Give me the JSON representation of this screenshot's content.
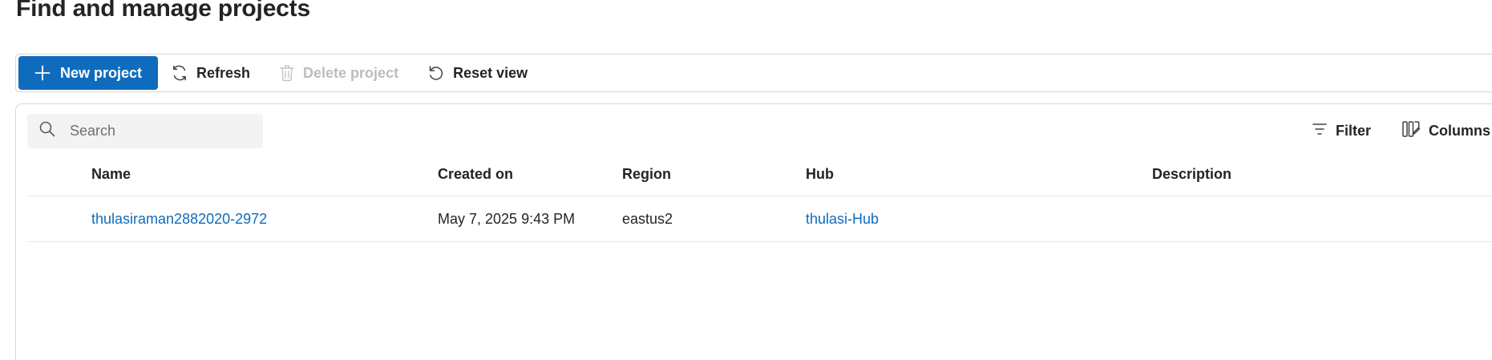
{
  "page": {
    "title": "Find and manage projects"
  },
  "toolbar": {
    "new_project_label": "New project",
    "refresh_label": "Refresh",
    "delete_project_label": "Delete project",
    "reset_view_label": "Reset view"
  },
  "grid": {
    "search_placeholder": "Search",
    "filter_label": "Filter",
    "columns_label": "Columns",
    "headers": {
      "name": "Name",
      "created_on": "Created on",
      "region": "Region",
      "hub": "Hub",
      "description": "Description"
    },
    "rows": [
      {
        "name": "thulasiraman2882020-2972",
        "created_on": "May 7, 2025 9:43 PM",
        "region": "eastus2",
        "hub": "thulasi-Hub",
        "description": ""
      }
    ]
  },
  "colors": {
    "primary": "#0f6cbd",
    "link": "#0f6cbd",
    "disabled": "#bdbdbd",
    "border": "#d6d6d6"
  },
  "icons": {
    "new_project": "plus-icon",
    "refresh": "refresh-icon",
    "delete": "trash-icon",
    "reset": "undo-icon",
    "search": "search-icon",
    "filter": "filter-icon",
    "columns": "columns-icon"
  }
}
